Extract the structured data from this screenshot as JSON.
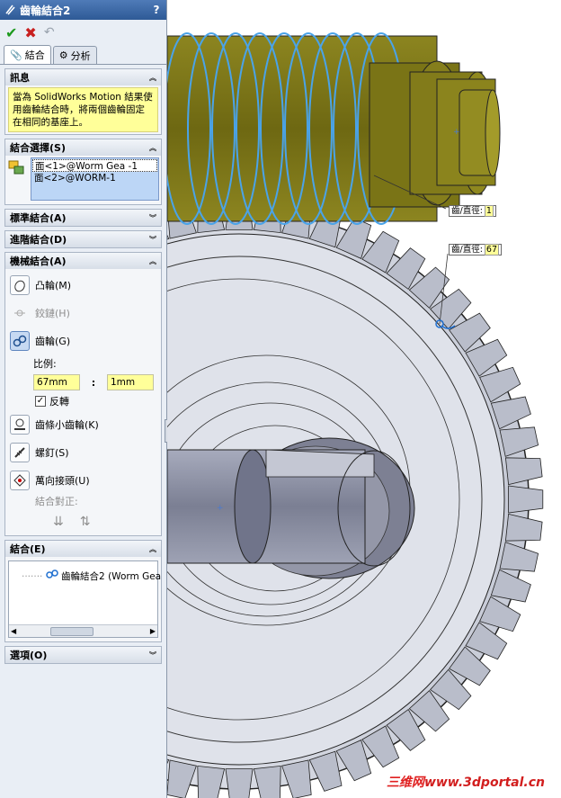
{
  "panel": {
    "title": "齒輪結合2",
    "help": "?",
    "tabs": [
      {
        "label": "結合",
        "icon": "paperclip-icon",
        "active": true
      },
      {
        "label": "分析",
        "icon": "analysis-icon",
        "active": false
      }
    ],
    "info": {
      "header": "訊息",
      "message": "當為 SolidWorks Motion 結果使用齒輪結合時，將兩個齒輪固定在相同的基座上。"
    },
    "selections": {
      "header": "結合選擇(S)",
      "items": [
        "面<1>@Worm Gea -1",
        "面<2>@WORM-1"
      ]
    },
    "standard": {
      "header": "標準結合(A)"
    },
    "advanced": {
      "header": "進階結合(D)"
    },
    "mechanical": {
      "header": "機械結合(A)",
      "items": [
        {
          "label": "凸輪(M)",
          "enabled": true,
          "active": false,
          "icon": "cam-icon"
        },
        {
          "label": "鉸鏈(H)",
          "enabled": false,
          "active": false,
          "icon": "hinge-icon"
        },
        {
          "label": "齒輪(G)",
          "enabled": true,
          "active": true,
          "icon": "gear-icon"
        }
      ],
      "ratio_label": "比例:",
      "ratio_left": "67mm",
      "ratio_right": "1mm",
      "colon": ":",
      "reverse_label": "反轉",
      "reverse_checked": true,
      "items2": [
        {
          "label": "齒條小齒輪(K)",
          "icon": "rack-pinion-icon"
        },
        {
          "label": "螺釘(S)",
          "icon": "screw-icon"
        },
        {
          "label": "萬向接頭(U)",
          "icon": "universal-joint-icon"
        }
      ],
      "alignment_label": "結合對正:"
    },
    "mates": {
      "header": "結合(E)",
      "item": "齒輪結合2 (Worm Gea"
    },
    "options": {
      "header": "選項(O)"
    }
  },
  "viewport": {
    "callout_1_label": "齒/直徑:",
    "callout_1_value": "1",
    "callout_2_label": "齒/直徑:",
    "callout_2_value": "67"
  },
  "watermark": {
    "cn": "三维网",
    "url": "www.3dportal.cn"
  },
  "colors": {
    "worm_body": "#7a7416",
    "worm_highlight": "#4aa3e8",
    "gear_body": "#d6d9e2",
    "shaft": "#8f93a6",
    "message_bg": "#ffff99",
    "title_bar": "#2e5a96"
  }
}
